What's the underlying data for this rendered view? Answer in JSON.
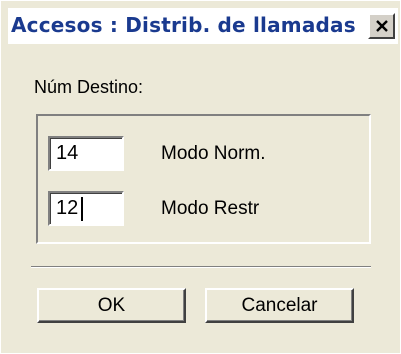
{
  "window": {
    "title": "Accesos : Distrib. de llamadas",
    "close_icon": "close-icon"
  },
  "form": {
    "destination_label": "Núm Destino:",
    "normal_mode": {
      "value": "14",
      "label": "Modo Norm."
    },
    "restricted_mode": {
      "value": "12",
      "label": "Modo Restr"
    }
  },
  "buttons": {
    "ok_label": "OK",
    "cancel_label": "Cancelar"
  },
  "colors": {
    "title_text": "#1a3a8f",
    "dialog_background": "#ece9d8",
    "titlebar_background": "#ffffff"
  }
}
